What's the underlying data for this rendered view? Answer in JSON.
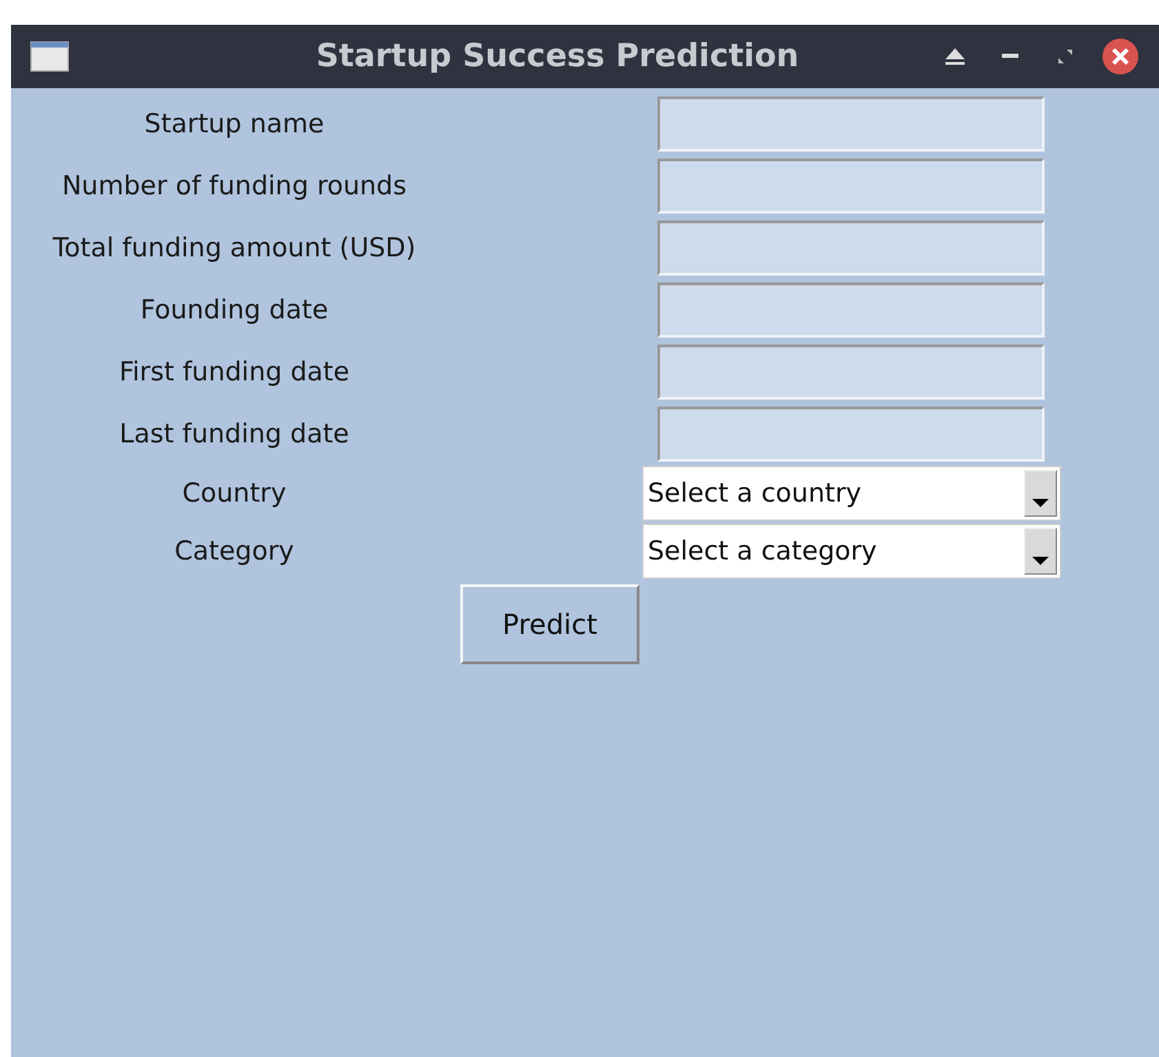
{
  "window": {
    "title": "Startup Success Prediction"
  },
  "fields": [
    {
      "kind": "entry",
      "label": "Startup name"
    },
    {
      "kind": "entry",
      "label": "Number of funding rounds"
    },
    {
      "kind": "entry",
      "label": "Total funding amount (USD)"
    },
    {
      "kind": "entry",
      "label": "Founding date"
    },
    {
      "kind": "entry",
      "label": "First funding date"
    },
    {
      "kind": "entry",
      "label": "Last funding date"
    },
    {
      "kind": "combo",
      "label": "Country",
      "value": "Select a country"
    },
    {
      "kind": "combo",
      "label": "Category",
      "value": "Select a category"
    }
  ],
  "button": "Predict"
}
